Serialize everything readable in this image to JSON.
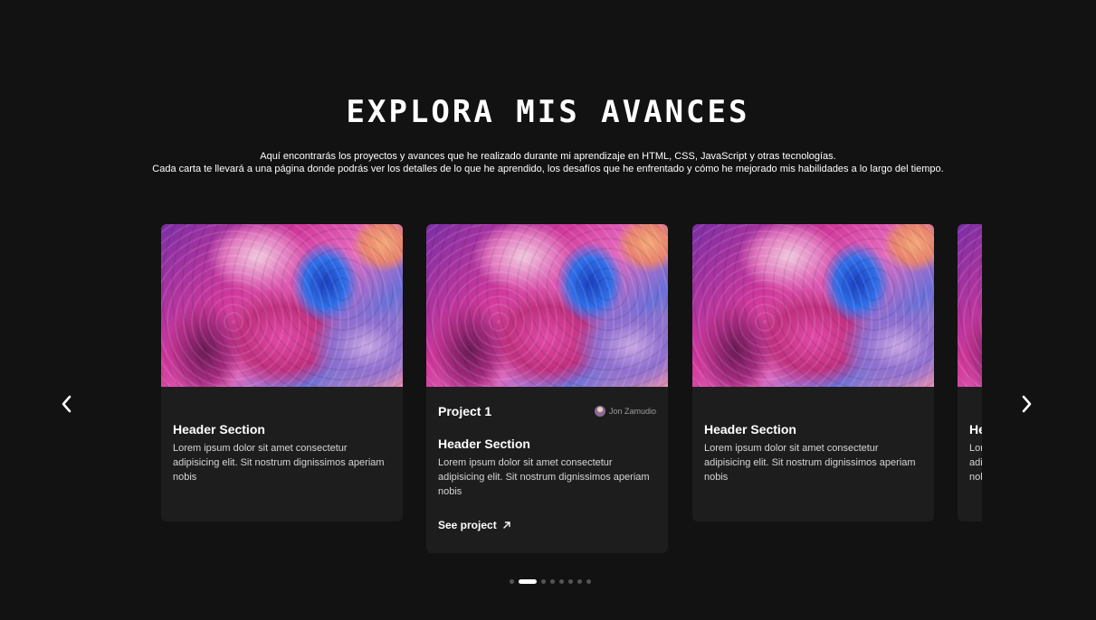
{
  "header": {
    "title": "Explora mis avances",
    "subtitle_line1": "Aquí encontrarás los proyectos y avances que he realizado durante mi aprendizaje en HTML, CSS, JavaScript y otras tecnologías.",
    "subtitle_line2": "Cada carta te llevará a una página donde podrás ver los detalles de lo que he aprendido, los desafíos que he enfrentado y cómo he mejorado mis habilidades a lo largo del tiempo."
  },
  "carousel": {
    "cards": [
      {
        "header": "Header Section",
        "text": "Lorem ipsum dolor sit amet consectetur adipisicing elit. Sit nostrum dignissimos aperiam nobis"
      },
      {
        "project_title": "Project 1",
        "author": "Jon Zamudio",
        "header": "Header Section",
        "text": "Lorem ipsum dolor sit amet consectetur adipisicing elit. Sit nostrum dignissimos aperiam nobis",
        "link_label": "See project"
      },
      {
        "header": "Header Section",
        "text": "Lorem ipsum dolor sit amet consectetur adipisicing elit. Sit nostrum dignissimos aperiam nobis"
      },
      {
        "header": "Header Section",
        "text": "Lorem ipsum dolor sit amet consectetur adipisicing elit. Sit nostrum dignissimos aperiam nobis"
      }
    ],
    "dots_count": 8,
    "active_dot": 1,
    "icons": {
      "prev": "chevron-left-icon",
      "next": "chevron-right-icon",
      "link": "arrow-up-right-icon"
    }
  },
  "colors": {
    "background": "#121212",
    "card": "#1d1d1d",
    "dot_inactive": "#555555",
    "dot_active": "#ffffff"
  }
}
